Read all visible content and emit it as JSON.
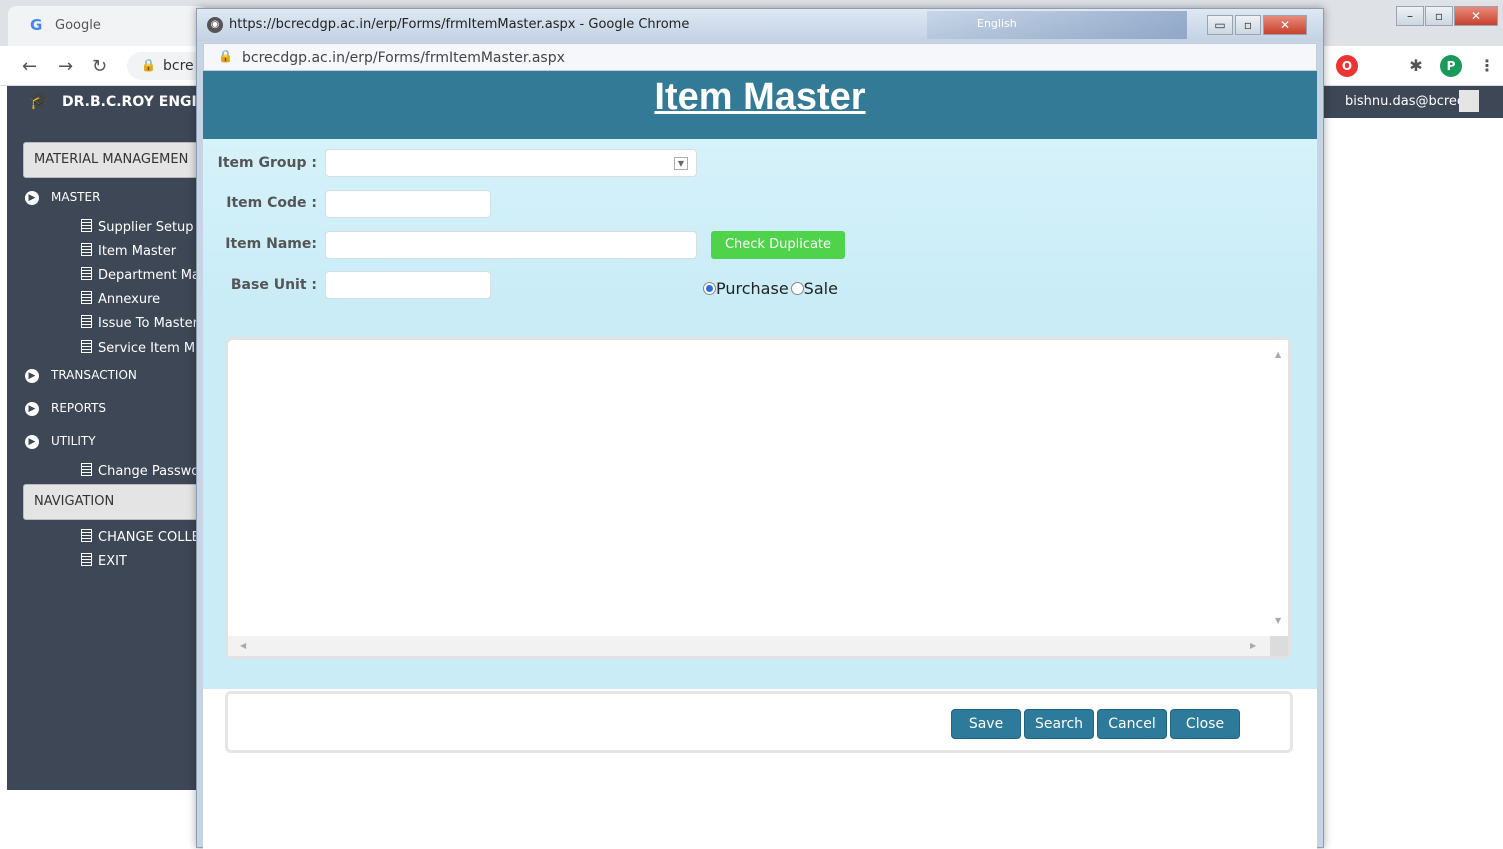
{
  "background_browser": {
    "tab_title": "Google",
    "tab_favicon": "G",
    "url_partial": "bcre",
    "profile_initial": "P"
  },
  "app_header": {
    "name": "DR.B.C.ROY ENGIN",
    "user": "bishnu.das@bcrec"
  },
  "sidebar": {
    "section_title": "MATERIAL MANAGEMEN",
    "master_label": "MASTER",
    "master_items": [
      {
        "label": "Supplier Setup"
      },
      {
        "label": "Item Master"
      },
      {
        "label": "Department Ma"
      },
      {
        "label": "Annexure"
      },
      {
        "label": "Issue To Master"
      },
      {
        "label": "Service Item Ma"
      }
    ],
    "transaction_label": "TRANSACTION",
    "reports_label": "REPORTS",
    "utility_label": "UTILITY",
    "utility_items": [
      {
        "label": "Change Passwor"
      }
    ],
    "navigation_title": "NAVIGATION",
    "navigation_items": [
      {
        "label": "CHANGE COLLE"
      },
      {
        "label": "EXIT"
      }
    ]
  },
  "popup": {
    "window_title": "https://bcrecdgp.ac.in/erp/Forms/frmItemMaster.aspx - Google Chrome",
    "address": "bcrecdgp.ac.in/erp/Forms/frmItemMaster.aspx",
    "taskbar_language": "English",
    "page_title": "Item Master",
    "form": {
      "item_group_label": "Item Group :",
      "item_group_value": "",
      "item_code_label": "Item Code :",
      "item_code_value": "",
      "item_name_label": "Item Name:",
      "item_name_value": "",
      "base_unit_label": "Base Unit :",
      "base_unit_value": "",
      "check_duplicate_label": "Check Duplicate",
      "radio_purchase_label": "Purchase",
      "radio_sale_label": "Sale",
      "selected_type": "Purchase"
    },
    "actions": {
      "save": "Save",
      "search": "Search",
      "cancel": "Cancel",
      "close": "Close"
    }
  },
  "colors": {
    "title_bar": "#337a96",
    "form_background": "#c9ecf7",
    "check_button": "#4ed34b",
    "action_button": "#2d7a9a",
    "sidebar": "#3e4756"
  }
}
